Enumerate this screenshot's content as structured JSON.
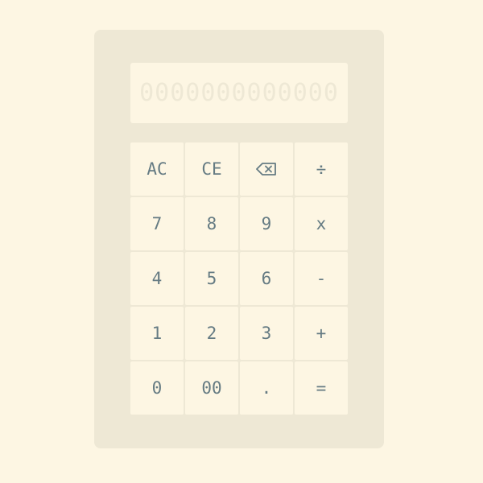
{
  "display": {
    "ghost_text": "0000000000000",
    "value": ""
  },
  "keys": [
    {
      "label": "AC",
      "name": "all-clear-button"
    },
    {
      "label": "CE",
      "name": "clear-entry-button"
    },
    {
      "label": "",
      "name": "backspace-button",
      "icon": "backspace-icon"
    },
    {
      "label": "÷",
      "name": "divide-button"
    },
    {
      "label": "7",
      "name": "digit-7-button"
    },
    {
      "label": "8",
      "name": "digit-8-button"
    },
    {
      "label": "9",
      "name": "digit-9-button"
    },
    {
      "label": "x",
      "name": "multiply-button"
    },
    {
      "label": "4",
      "name": "digit-4-button"
    },
    {
      "label": "5",
      "name": "digit-5-button"
    },
    {
      "label": "6",
      "name": "digit-6-button"
    },
    {
      "label": "-",
      "name": "subtract-button"
    },
    {
      "label": "1",
      "name": "digit-1-button"
    },
    {
      "label": "2",
      "name": "digit-2-button"
    },
    {
      "label": "3",
      "name": "digit-3-button"
    },
    {
      "label": "+",
      "name": "add-button"
    },
    {
      "label": "0",
      "name": "digit-0-button"
    },
    {
      "label": "00",
      "name": "double-zero-button"
    },
    {
      "label": ".",
      "name": "decimal-point-button"
    },
    {
      "label": "=",
      "name": "equals-button"
    }
  ],
  "colors": {
    "page_background": "#fdf6e3",
    "body": "#eee8d5",
    "key_background": "#fdf6e3",
    "key_text": "#657b83"
  }
}
